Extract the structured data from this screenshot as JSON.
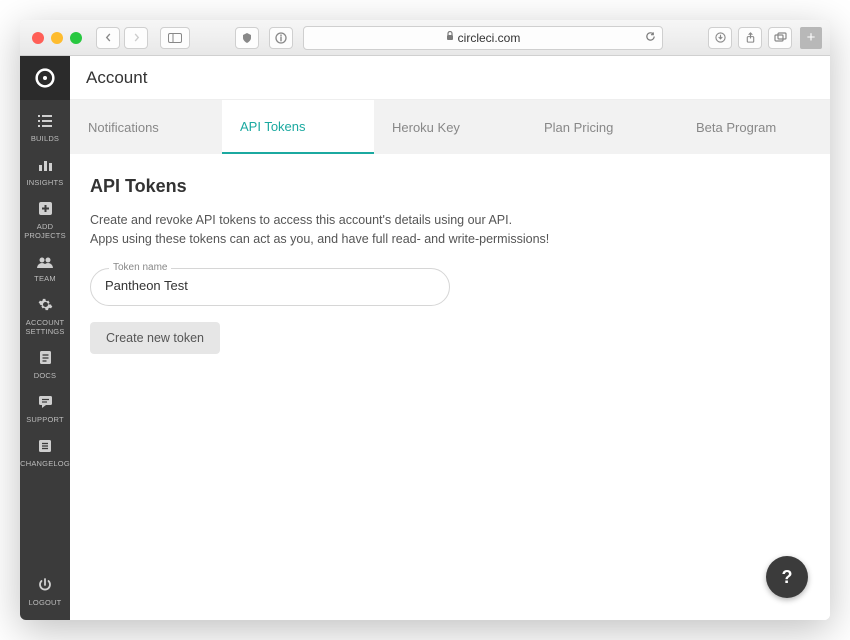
{
  "browser": {
    "url_display": "circleci.com"
  },
  "page": {
    "title": "Account"
  },
  "sidebar": {
    "items": [
      {
        "label": "BUILDS"
      },
      {
        "label": "INSIGHTS"
      },
      {
        "label": "ADD\nPROJECTS"
      },
      {
        "label": "TEAM"
      },
      {
        "label": "ACCOUNT\nSETTINGS"
      },
      {
        "label": "DOCS"
      },
      {
        "label": "SUPPORT"
      },
      {
        "label": "CHANGELOG"
      }
    ],
    "logout_label": "LOGOUT"
  },
  "tabs": [
    {
      "label": "Notifications"
    },
    {
      "label": "API Tokens"
    },
    {
      "label": "Heroku Key"
    },
    {
      "label": "Plan Pricing"
    },
    {
      "label": "Beta Program"
    }
  ],
  "section": {
    "title": "API Tokens",
    "desc_line1": "Create and revoke API tokens to access this account's details using our API.",
    "desc_line2": "Apps using these tokens can act as you, and have full read- and write-permissions!",
    "field_label": "Token name",
    "field_value": "Pantheon Test",
    "button_label": "Create new token"
  },
  "fab": {
    "label": "?"
  }
}
